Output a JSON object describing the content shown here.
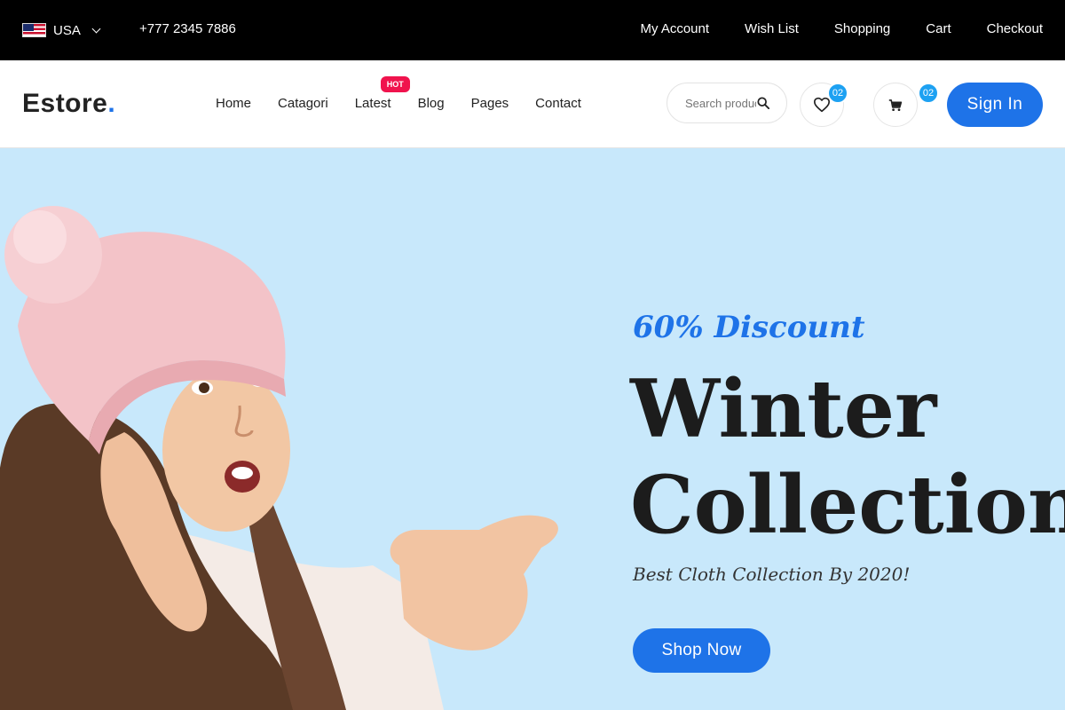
{
  "topbar": {
    "country": "USA",
    "phone": "+777 2345 7886",
    "links": [
      "My Account",
      "Wish List",
      "Shopping",
      "Cart",
      "Checkout"
    ]
  },
  "header": {
    "logo": "Estore",
    "logo_dot": ".",
    "nav": [
      "Home",
      "Catagori",
      "Latest",
      "Blog",
      "Pages",
      "Contact"
    ],
    "hot_badge": "HOT",
    "search_placeholder": "Search product",
    "wishlist_count": "02",
    "cart_count": "02",
    "signin_label": "Sign In"
  },
  "hero": {
    "discount": "60% Discount",
    "headline_line1": "Winter",
    "headline_line2": "Collection",
    "tagline": "Best Cloth Collection By 2020!",
    "cta": "Shop Now"
  },
  "colors": {
    "accent": "#1e73e8",
    "hero_bg": "#c8e8fb",
    "hot": "#f0134d",
    "badge": "#1da1f2"
  },
  "icons": [
    "us-flag-icon",
    "chevron-down-icon",
    "search-icon",
    "heart-icon",
    "cart-icon"
  ]
}
